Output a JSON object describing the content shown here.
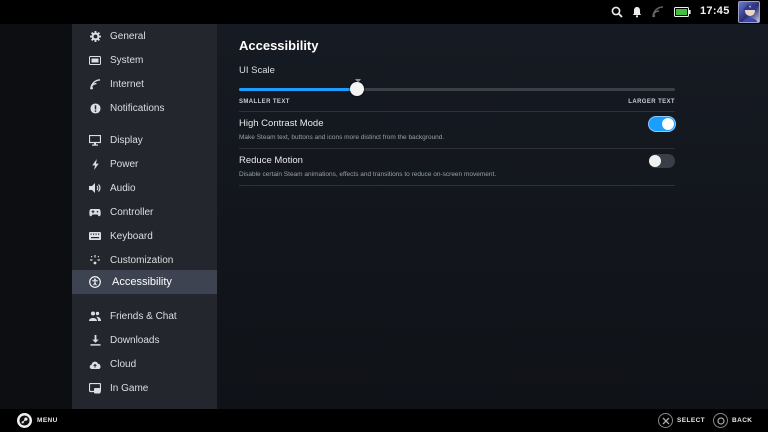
{
  "status_bar": {
    "time": "17:45",
    "icons": [
      "search-icon",
      "notifications-icon",
      "wifi-icon",
      "battery-icon",
      "avatar"
    ]
  },
  "sidebar": {
    "items": [
      {
        "label": "General",
        "icon": "gear-icon"
      },
      {
        "label": "System",
        "icon": "system-icon"
      },
      {
        "label": "Internet",
        "icon": "wifi-icon"
      },
      {
        "label": "Notifications",
        "icon": "info-icon"
      },
      {
        "label": "Display",
        "icon": "monitor-icon"
      },
      {
        "label": "Power",
        "icon": "lightning-icon"
      },
      {
        "label": "Audio",
        "icon": "speaker-icon"
      },
      {
        "label": "Controller",
        "icon": "gamepad-icon"
      },
      {
        "label": "Keyboard",
        "icon": "keyboard-icon"
      },
      {
        "label": "Customization",
        "icon": "sparkle-icon"
      },
      {
        "label": "Accessibility",
        "icon": "accessibility-icon",
        "active": true
      },
      {
        "label": "Friends & Chat",
        "icon": "friends-icon"
      },
      {
        "label": "Downloads",
        "icon": "download-icon"
      },
      {
        "label": "Cloud",
        "icon": "cloud-icon"
      },
      {
        "label": "In Game",
        "icon": "ingame-icon"
      }
    ]
  },
  "main": {
    "title": "Accessibility",
    "ui_scale": {
      "label": "UI Scale",
      "min_label": "SMALLER TEXT",
      "max_label": "LARGER TEXT",
      "value_fraction": 0.27
    },
    "settings": [
      {
        "title": "High Contrast Mode",
        "description": "Make Steam text, buttons and icons more distinct from the background.",
        "enabled": true
      },
      {
        "title": "Reduce Motion",
        "description": "Disable certain Steam animations, effects and transitions to reduce on-screen movement.",
        "enabled": false
      }
    ]
  },
  "bottom_bar": {
    "menu_label": "MENU",
    "select_label": "SELECT",
    "back_label": "BACK"
  },
  "colors": {
    "accent": "#1a9fff",
    "sidebar_bg": "#23262d",
    "sidebar_active": "#3d4350",
    "main_bg": "#161a22"
  }
}
